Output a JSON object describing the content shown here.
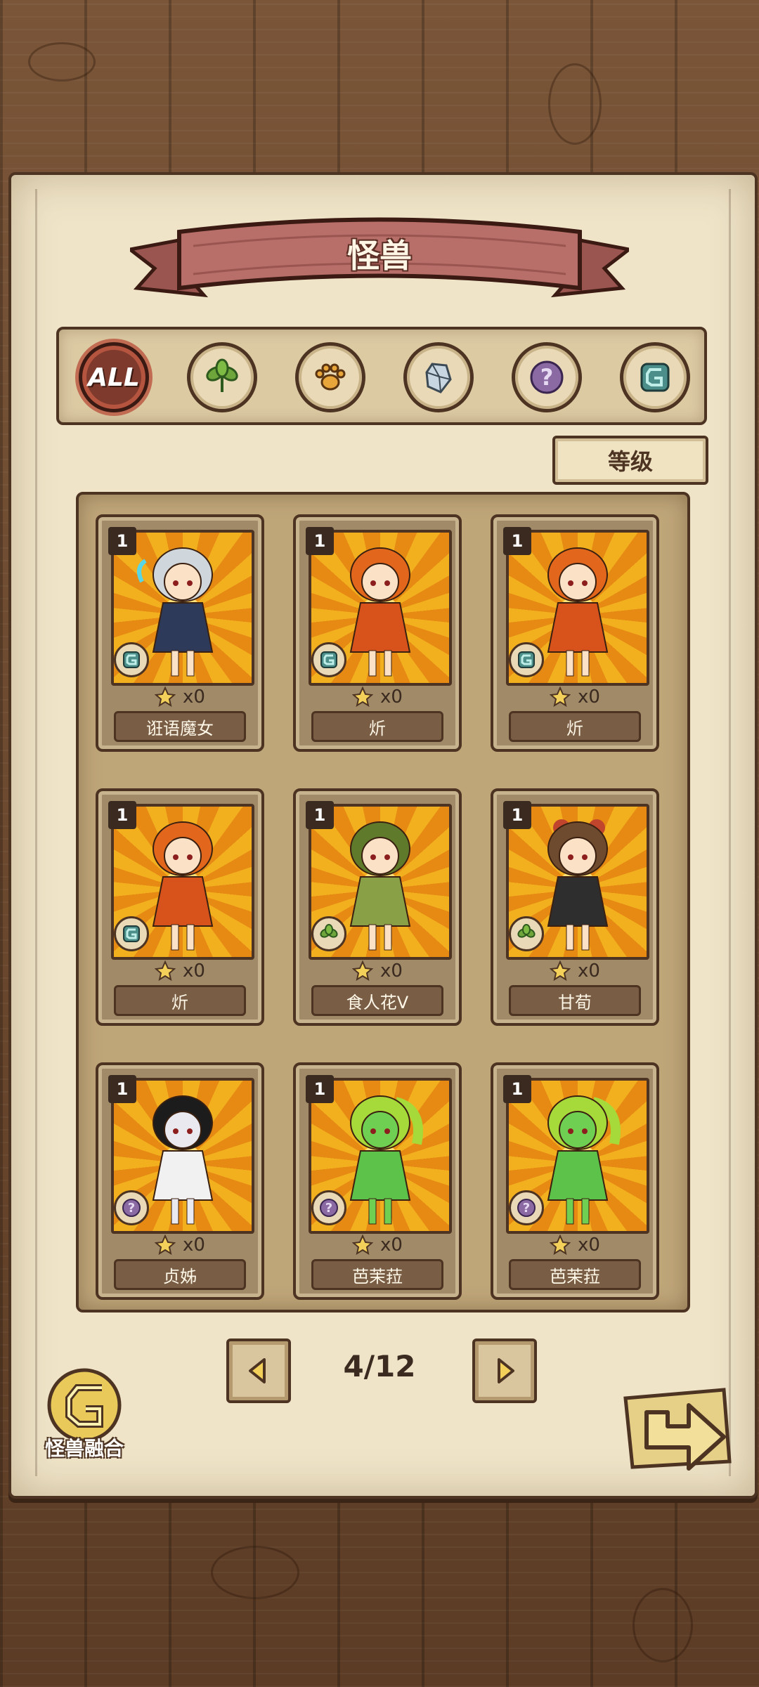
{
  "header": {
    "title": "怪兽"
  },
  "filters": [
    {
      "id": "all",
      "label": "ALL",
      "icon": "all-icon",
      "active": true
    },
    {
      "id": "plant",
      "icon": "leaf-icon",
      "active": false
    },
    {
      "id": "beast",
      "icon": "paw-icon",
      "active": false
    },
    {
      "id": "crystal",
      "icon": "crystal-icon",
      "active": false
    },
    {
      "id": "unknown",
      "icon": "question-icon",
      "active": false
    },
    {
      "id": "magic",
      "icon": "rune-icon",
      "active": false
    }
  ],
  "sort": {
    "label": "等级"
  },
  "cards": [
    {
      "level": "1",
      "count": "x0",
      "name": "诳语魔女",
      "type": "rune-icon",
      "character": "witch"
    },
    {
      "level": "1",
      "count": "x0",
      "name": "炘",
      "type": "rune-icon",
      "character": "flame-girl"
    },
    {
      "level": "1",
      "count": "x0",
      "name": "炘",
      "type": "rune-icon",
      "character": "flame-girl"
    },
    {
      "level": "1",
      "count": "x0",
      "name": "炘",
      "type": "rune-icon",
      "character": "flame-girl"
    },
    {
      "level": "1",
      "count": "x0",
      "name": "食人花V",
      "type": "leaf-icon",
      "character": "plant-girl"
    },
    {
      "level": "1",
      "count": "x0",
      "name": "甘荀",
      "type": "leaf-icon",
      "character": "carrot-girl"
    },
    {
      "level": "1",
      "count": "x0",
      "name": "贞姊",
      "type": "question-icon",
      "character": "ghost-girl"
    },
    {
      "level": "1",
      "count": "x0",
      "name": "芭茉菈",
      "type": "question-icon",
      "character": "slime-girl"
    },
    {
      "level": "1",
      "count": "x0",
      "name": "芭茉菈",
      "type": "question-icon",
      "character": "slime-girl"
    }
  ],
  "pagination": {
    "current": 4,
    "total": 12,
    "text": "4/12"
  },
  "actions": {
    "fusion_label": "怪兽融合"
  },
  "colors": {
    "wood": "#6e4a30",
    "parchment": "#efe4c8",
    "outline": "#4d3322",
    "banner": "#b86f6a",
    "card_bg": "#f2b01f"
  }
}
